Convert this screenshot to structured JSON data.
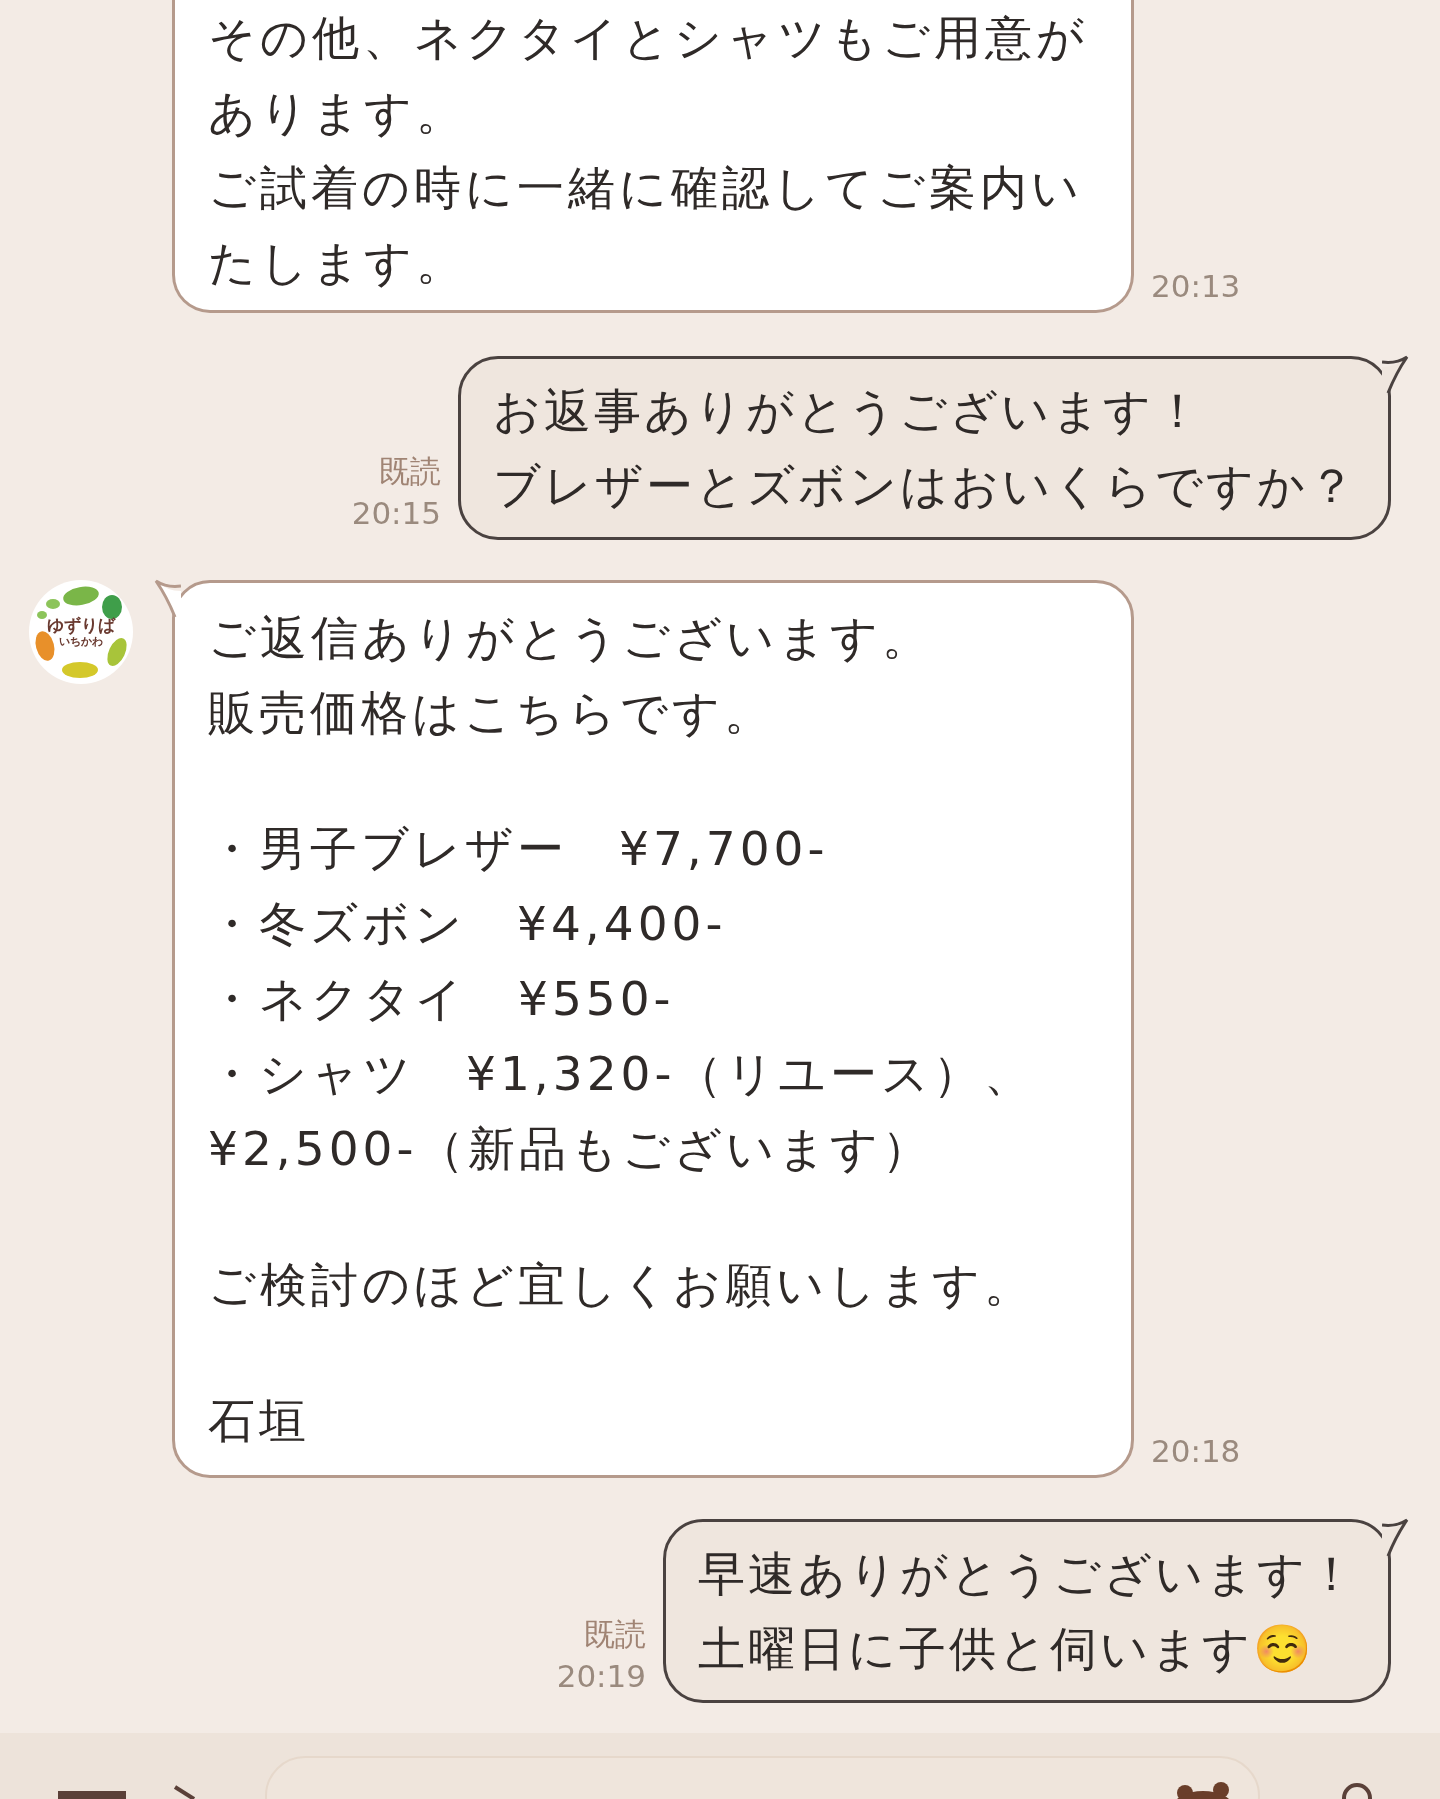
{
  "messages": [
    {
      "kind": "received",
      "paragraphs": [
        [
          "その他、ネクタイとシャツもご用意が",
          "あります。",
          "ご試着の時に一緒に確認してご案内い",
          "たします。"
        ]
      ],
      "time": "20:13"
    },
    {
      "kind": "sent",
      "tail": true,
      "paragraphs": [
        [
          "お返事ありがとうございます！",
          "ブレザーとズボンはおいくらですか？"
        ]
      ],
      "read": "既読",
      "time": "20:15"
    },
    {
      "kind": "received",
      "tail": true,
      "avatar": {
        "name": "ゆずりば",
        "sub": "いちかわ"
      },
      "paragraphs": [
        [
          "ご返信ありがとうございます。",
          "販売価格はこちらです。"
        ],
        [
          "・男子ブレザー　¥7,700-",
          "・冬ズボン　¥4,400-",
          "・ネクタイ　¥550-",
          "・シャツ　¥1,320-（リユース）、",
          "¥2,500-（新品もございます）"
        ],
        [
          "ご検討のほど宜しくお願いします。"
        ],
        [
          "石垣"
        ]
      ],
      "time": "20:18"
    },
    {
      "kind": "sent",
      "tail": true,
      "paragraphs": [
        [
          "早速ありがとうございます！",
          "土曜日に子供と伺います☺️"
        ]
      ],
      "read": "既読",
      "time": "20:19"
    }
  ]
}
